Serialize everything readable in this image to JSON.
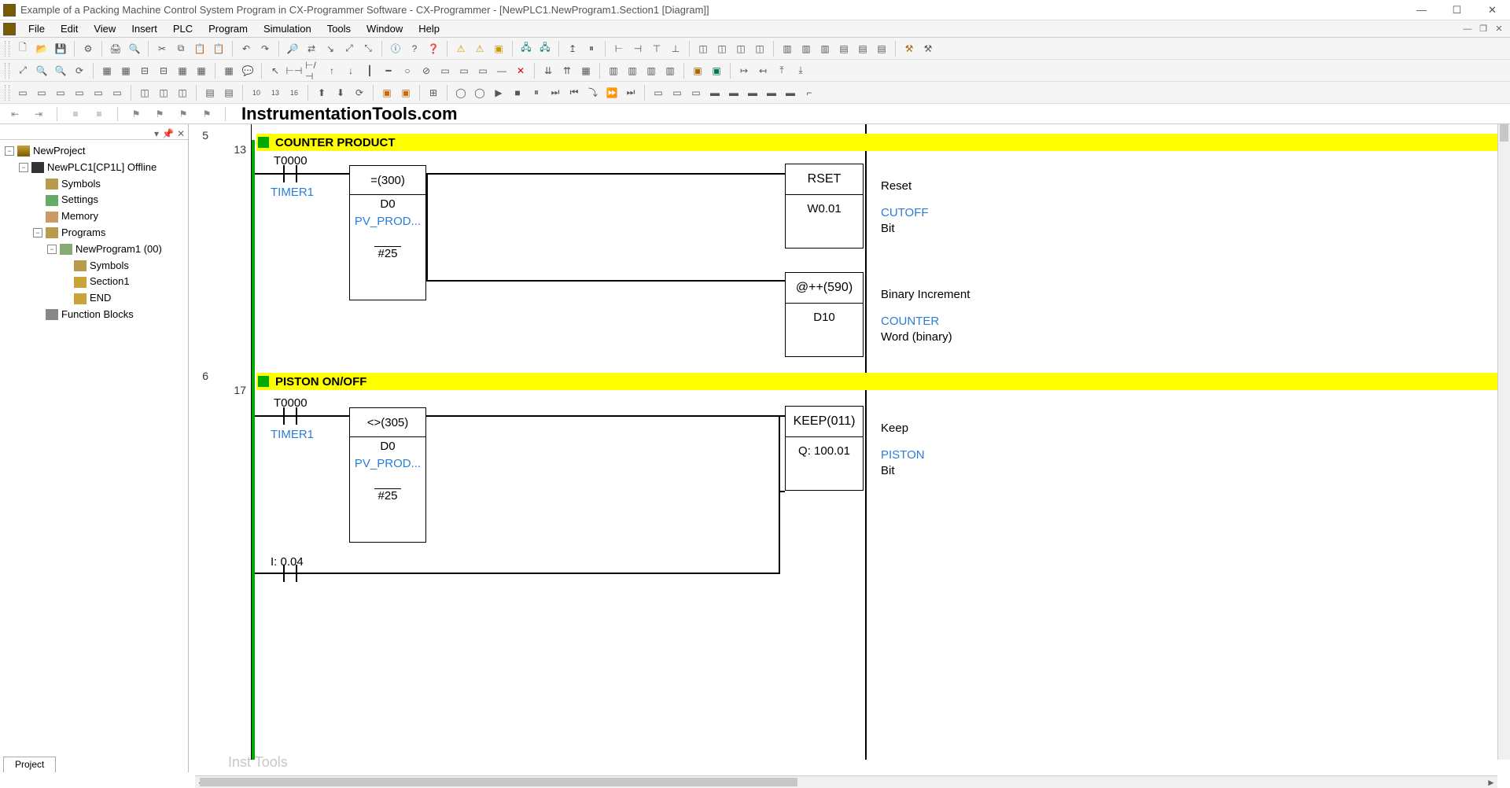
{
  "window": {
    "title": "Example of a Packing Machine Control System Program in CX-Programmer Software - CX-Programmer - [NewPLC1.NewProgram1.Section1 [Diagram]]"
  },
  "menu": {
    "items": [
      "File",
      "Edit",
      "View",
      "Insert",
      "PLC",
      "Program",
      "Simulation",
      "Tools",
      "Window",
      "Help"
    ]
  },
  "watermark": {
    "text": "InstrumentationTools.com",
    "ghost": "Inst Tools"
  },
  "tree": {
    "root": "NewProject",
    "plc": "NewPLC1[CP1L] Offline",
    "symbols": "Symbols",
    "settings": "Settings",
    "memory": "Memory",
    "programs": "Programs",
    "program": "NewProgram1 (00)",
    "psymbols": "Symbols",
    "section": "Section1",
    "end": "END",
    "fblocks": "Function Blocks"
  },
  "sidebar_tab": "Project",
  "rungs": [
    {
      "step": "5",
      "addr": "13",
      "title": "COUNTER PRODUCT",
      "contact": {
        "tag": "T0000",
        "name": "TIMER1"
      },
      "func": {
        "op": "=(300)",
        "arg1": "D0",
        "arg1name": "PV_PROD...",
        "arg2": "#25"
      },
      "out1": {
        "top": "RSET",
        "bot": "W0.01",
        "c1": "Reset",
        "c2": "CUTOFF",
        "c3": "Bit"
      },
      "out2": {
        "top": "@++(590)",
        "bot": "D10",
        "c1": "Binary Increment",
        "c2": "COUNTER",
        "c3": "Word (binary)"
      }
    },
    {
      "step": "6",
      "addr": "17",
      "title": "PISTON ON/OFF",
      "contact": {
        "tag": "T0000",
        "name": "TIMER1"
      },
      "func": {
        "op": "<>(305)",
        "arg1": "D0",
        "arg1name": "PV_PROD...",
        "arg2": "#25"
      },
      "out1": {
        "top": "KEEP(011)",
        "bot": "Q: 100.01",
        "c1": "Keep",
        "c2": "PISTON",
        "c3": "Bit"
      },
      "input2": "I: 0.04"
    }
  ]
}
